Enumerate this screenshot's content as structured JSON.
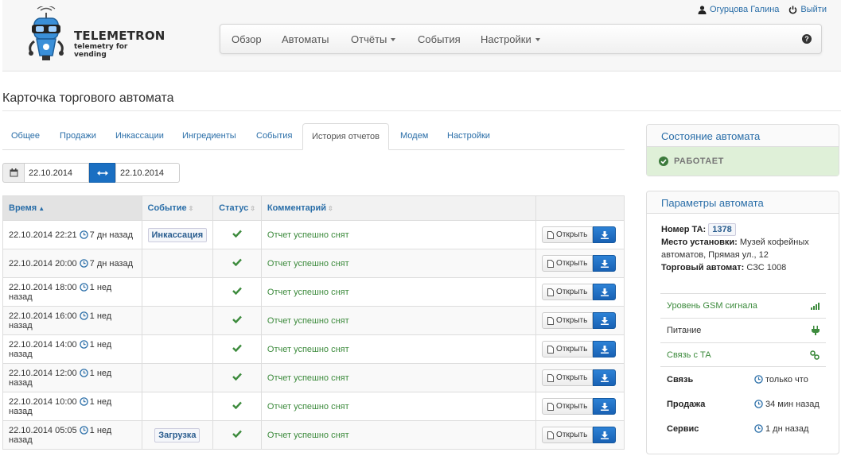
{
  "brand": {
    "title": "TELEMETRON",
    "subtitle": "telemetry for vending"
  },
  "user": {
    "name": "Огурцова Галина",
    "logout": "Выйти"
  },
  "nav": {
    "items": [
      {
        "label": "Обзор"
      },
      {
        "label": "Автоматы"
      },
      {
        "label": "Отчёты",
        "dropdown": true
      },
      {
        "label": "События"
      },
      {
        "label": "Настройки",
        "dropdown": true
      }
    ],
    "help": "?"
  },
  "page_title": "Карточка торгового автомата",
  "tabs": [
    {
      "label": "Общее"
    },
    {
      "label": "Продажи"
    },
    {
      "label": "Инкассации"
    },
    {
      "label": "Ингредиенты"
    },
    {
      "label": "События"
    },
    {
      "label": "История отчетов",
      "active": true
    },
    {
      "label": "Модем"
    },
    {
      "label": "Настройки"
    }
  ],
  "daterange": {
    "from": "22.10.2014",
    "to": "22.10.2014"
  },
  "table": {
    "columns": [
      "Время",
      "Событие",
      "Статус",
      "Комментарий"
    ],
    "open_label": "Открыть",
    "rows": [
      {
        "time": "22.10.2014 22:21",
        "ago": "7 дн назад",
        "event": "Инкассация",
        "comment": "Отчет успешно снят"
      },
      {
        "time": "22.10.2014 20:00",
        "ago": "7 дн назад",
        "event": "",
        "comment": "Отчет успешно снят"
      },
      {
        "time": "22.10.2014 18:00",
        "ago": "1 нед назад",
        "event": "",
        "comment": "Отчет успешно снят"
      },
      {
        "time": "22.10.2014 16:00",
        "ago": "1 нед назад",
        "event": "",
        "comment": "Отчет успешно снят"
      },
      {
        "time": "22.10.2014 14:00",
        "ago": "1 нед назад",
        "event": "",
        "comment": "Отчет успешно снят"
      },
      {
        "time": "22.10.2014 12:00",
        "ago": "1 нед назад",
        "event": "",
        "comment": "Отчет успешно снят"
      },
      {
        "time": "22.10.2014 10:00",
        "ago": "1 нед назад",
        "event": "",
        "comment": "Отчет успешно снят"
      },
      {
        "time": "22.10.2014 05:05",
        "ago": "1 нед назад",
        "event": "Загрузка",
        "comment": "Отчет успешно снят"
      }
    ]
  },
  "state_panel": {
    "title": "Состояние автомата",
    "status": "РАБОТАЕТ",
    "status_color": "#dff0d8"
  },
  "params_panel": {
    "title": "Параметры автомата",
    "number_label": "Номер ТА:",
    "number": "1378",
    "location_label": "Место установки:",
    "location": "Музей кофейных автоматов, Прямая ул., 12",
    "machine_label": "Торговый автомат:",
    "machine": "СЗС 1008",
    "indicators": [
      {
        "label": "Уровень GSM сигнала",
        "icon": "signal-icon",
        "green": true
      },
      {
        "label": "Питание",
        "icon": "plug-icon",
        "green": false
      },
      {
        "label": "Связь с ТА",
        "icon": "link-icon",
        "green": true
      }
    ],
    "statuses": [
      {
        "label": "Связь",
        "value": "только что"
      },
      {
        "label": "Продажа",
        "value": "34 мин назад"
      },
      {
        "label": "Сервис",
        "value": "1 дн назад"
      }
    ]
  }
}
